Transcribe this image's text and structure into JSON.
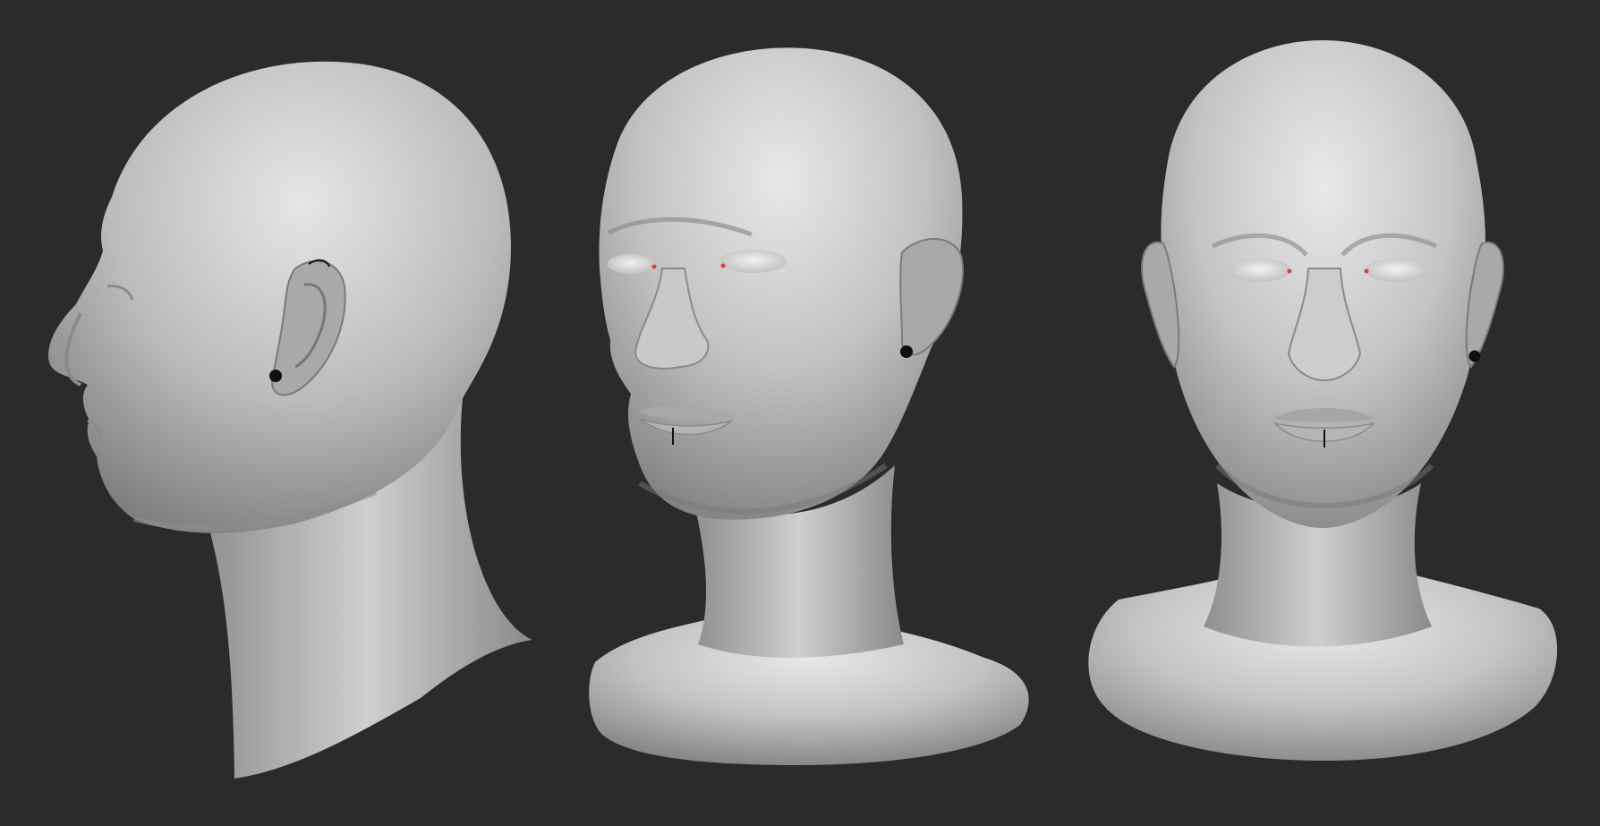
{
  "scene": {
    "background_color": "#2b2b2b",
    "material_color": "#bdbdbd",
    "eye_accent_color": "#d9433a",
    "earring_color": "#101010",
    "views": [
      {
        "id": "side",
        "description_name": "profile-left"
      },
      {
        "id": "three-quarter",
        "description_name": "three-quarter-left"
      },
      {
        "id": "front",
        "description_name": "front"
      }
    ]
  }
}
